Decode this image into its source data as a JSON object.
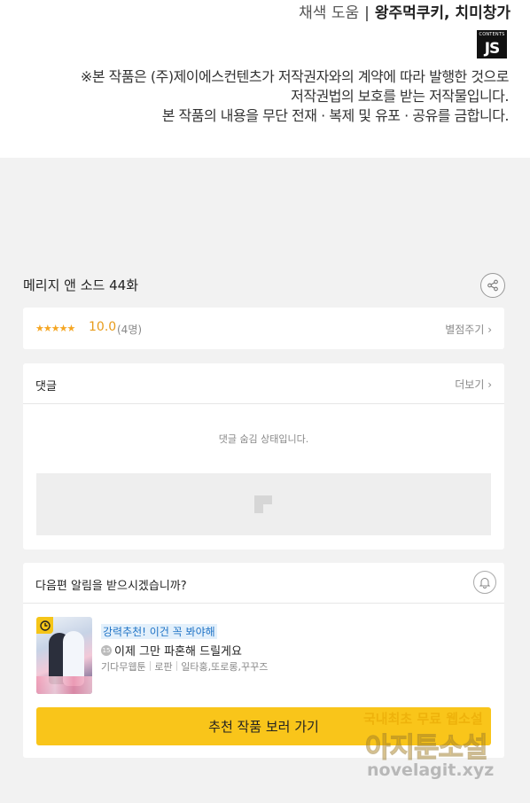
{
  "header": {
    "credits_prefix": "채색 도움",
    "credits_separator": "|",
    "credits_names": "왕주먹쿠키, 치미창가",
    "logo_small": "CONTENTS",
    "logo_big": "JS",
    "notice": [
      "※본 작품은 (주)제이에스컨텐츠가 저작권자와의 계약에 따라 발행한 것으로",
      "저작권법의 보호를 받는 저작물입니다.",
      "본 작품의 내용을 무단 전재 · 복제 및 유포 · 공유를 금합니다."
    ]
  },
  "episode": {
    "title": "메리지 앤 소드 44화",
    "share_icon": "share-icon"
  },
  "rating": {
    "stars": "★★★★★",
    "score": "10.0",
    "count": "(4명)",
    "rate_link": "별점주기 ›"
  },
  "comments": {
    "title": "댓글",
    "more_link": "더보기 ›",
    "hidden_message": "댓글 숨김 상태입니다."
  },
  "next": {
    "question": "다음편 알림을 받으시겠습니까?",
    "bell_icon": "bell-icon",
    "recommend_tag": "강력추천! 이건 꼭 봐야해",
    "age_badge": "15",
    "recommend_title": "이제 그만 파혼해 드릴게요",
    "meta": [
      "기다무웹툰",
      "로판",
      "일타홍,또로롱,꾸꾸즈"
    ],
    "cta_label": "추천 작품 보러 가기"
  },
  "watermark": {
    "line1": "국내최초 무료 웹소설",
    "line2": "아지툰소설",
    "line3": "novelagit.xyz"
  },
  "colors": {
    "accent_yellow": "#f9c51a",
    "star_orange": "#f5a623",
    "link_blue": "#1f73c6",
    "background": "#f2f2f2"
  }
}
